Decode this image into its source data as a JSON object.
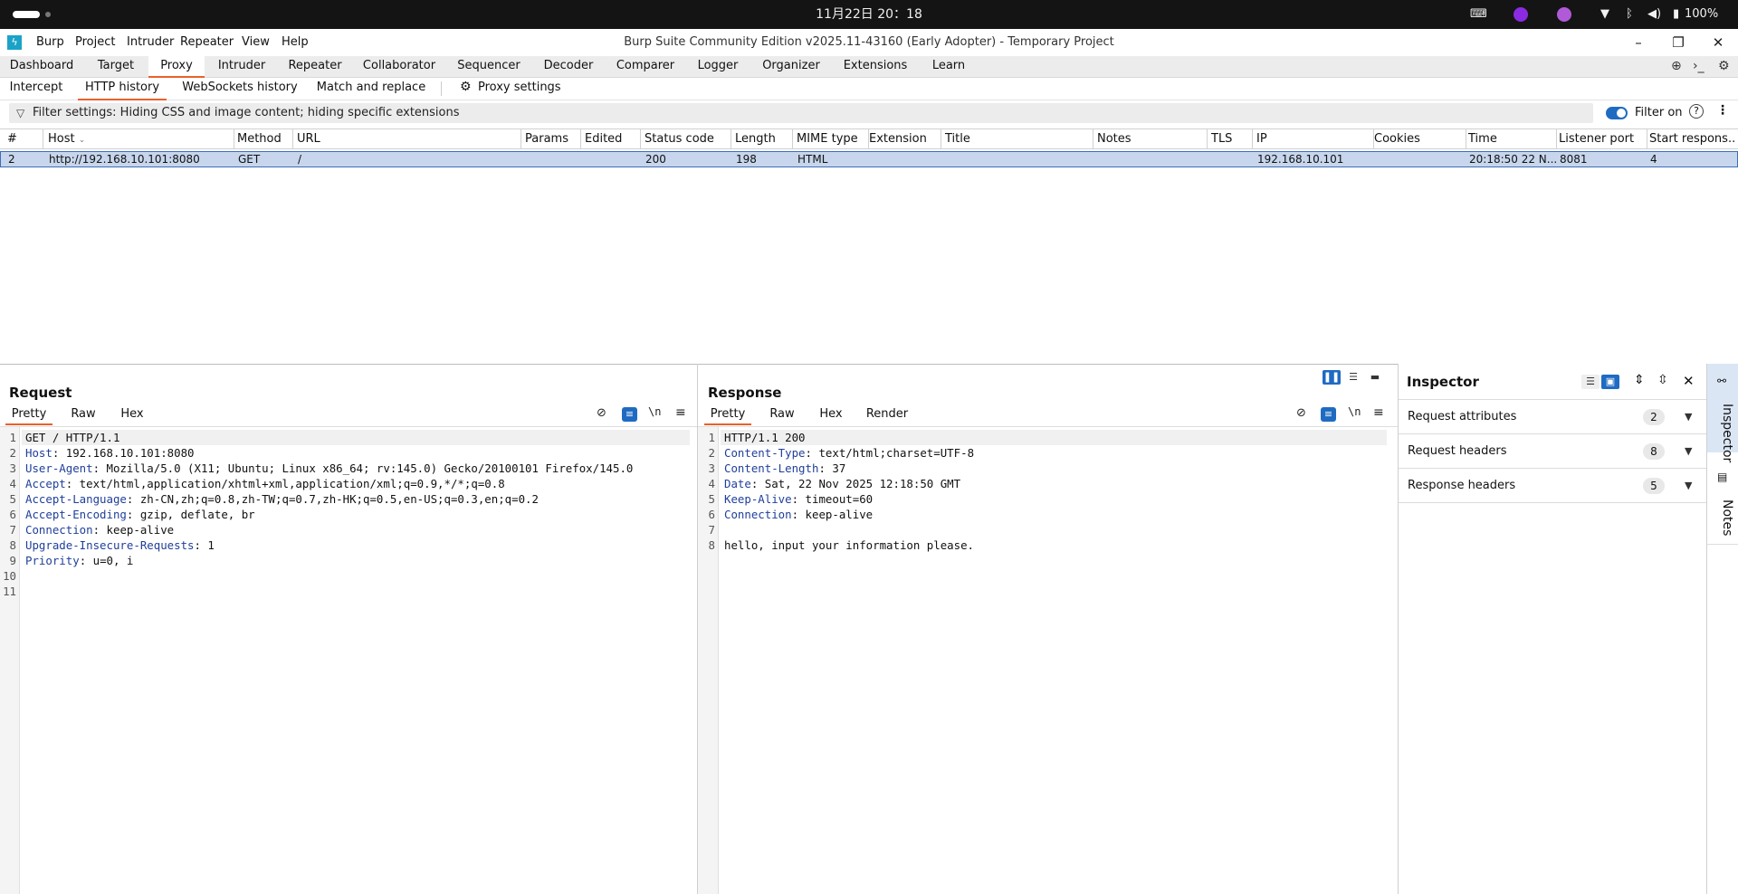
{
  "system_bar": {
    "clock": "11月22日  20：18",
    "battery": "100%"
  },
  "menu": {
    "items": [
      "Burp",
      "Project",
      "Intruder",
      "Repeater",
      "View",
      "Help"
    ]
  },
  "window": {
    "title": "Burp Suite Community Edition v2025.11-43160 (Early Adopter) - Temporary Project"
  },
  "main_tabs": {
    "items": [
      "Dashboard",
      "Target",
      "Proxy",
      "Intruder",
      "Repeater",
      "Collaborator",
      "Sequencer",
      "Decoder",
      "Comparer",
      "Logger",
      "Organizer",
      "Extensions",
      "Learn"
    ],
    "active": "Proxy"
  },
  "sub_tabs": {
    "items": [
      "Intercept",
      "HTTP history",
      "WebSockets history",
      "Match and replace"
    ],
    "active": "HTTP history",
    "settings": "Proxy settings"
  },
  "filter": {
    "text": "Filter settings: Hiding CSS and image content; hiding specific extensions",
    "toggle_label": "Filter on",
    "enabled": true
  },
  "table": {
    "columns": [
      "#",
      "Host",
      "Method",
      "URL",
      "Params",
      "Edited",
      "Status code",
      "Length",
      "MIME type",
      "Extension",
      "Title",
      "Notes",
      "TLS",
      "IP",
      "Cookies",
      "Time",
      "Listener port",
      "Start respons..."
    ],
    "rows": [
      [
        "2",
        "http://192.168.10.101:8080",
        "GET",
        "/",
        "",
        "",
        "200",
        "198",
        "HTML",
        "",
        "",
        "",
        "",
        "192.168.10.101",
        "",
        "20:18:50 22 N...",
        "8081",
        "4"
      ]
    ]
  },
  "request": {
    "title": "Request",
    "tabs": [
      "Pretty",
      "Raw",
      "Hex"
    ],
    "active_tab": "Pretty",
    "lines": [
      {
        "n": "1",
        "k": "",
        "v": "GET / HTTP/1.1"
      },
      {
        "n": "2",
        "k": "Host",
        "v": ": 192.168.10.101:8080"
      },
      {
        "n": "3",
        "k": "User-Agent",
        "v": ": Mozilla/5.0 (X11; Ubuntu; Linux x86_64; rv:145.0) Gecko/20100101 Firefox/145.0"
      },
      {
        "n": "4",
        "k": "Accept",
        "v": ": text/html,application/xhtml+xml,application/xml;q=0.9,*/*;q=0.8"
      },
      {
        "n": "5",
        "k": "Accept-Language",
        "v": ": zh-CN,zh;q=0.8,zh-TW;q=0.7,zh-HK;q=0.5,en-US;q=0.3,en;q=0.2"
      },
      {
        "n": "6",
        "k": "Accept-Encoding",
        "v": ": gzip, deflate, br"
      },
      {
        "n": "7",
        "k": "Connection",
        "v": ": keep-alive"
      },
      {
        "n": "8",
        "k": "Upgrade-Insecure-Requests",
        "v": ": 1"
      },
      {
        "n": "9",
        "k": "Priority",
        "v": ": u=0, i"
      },
      {
        "n": "10",
        "k": "",
        "v": ""
      },
      {
        "n": "11",
        "k": "",
        "v": ""
      }
    ]
  },
  "response": {
    "title": "Response",
    "tabs": [
      "Pretty",
      "Raw",
      "Hex",
      "Render"
    ],
    "active_tab": "Pretty",
    "lines": [
      {
        "n": "1",
        "k": "",
        "v": "HTTP/1.1 200"
      },
      {
        "n": "2",
        "k": "Content-Type",
        "v": ": text/html;charset=UTF-8"
      },
      {
        "n": "3",
        "k": "Content-Length",
        "v": ": 37"
      },
      {
        "n": "4",
        "k": "Date",
        "v": ": Sat, 22 Nov 2025 12:18:50 GMT"
      },
      {
        "n": "5",
        "k": "Keep-Alive",
        "v": ": timeout=60"
      },
      {
        "n": "6",
        "k": "Connection",
        "v": ": keep-alive"
      },
      {
        "n": "7",
        "k": "",
        "v": ""
      },
      {
        "n": "8",
        "k": "",
        "v": "hello, input your information please."
      }
    ]
  },
  "wrap_label": "\\n",
  "inspector": {
    "title": "Inspector",
    "sections": [
      {
        "label": "Request attributes",
        "count": "2"
      },
      {
        "label": "Request headers",
        "count": "8"
      },
      {
        "label": "Response headers",
        "count": "5"
      }
    ]
  },
  "side_tabs": [
    "Inspector",
    "Notes"
  ],
  "colors": {
    "accent": "#e8612c",
    "selection": "#c7d6ec",
    "toggle": "#1f6bc2",
    "header_key": "#1f3f9a"
  }
}
